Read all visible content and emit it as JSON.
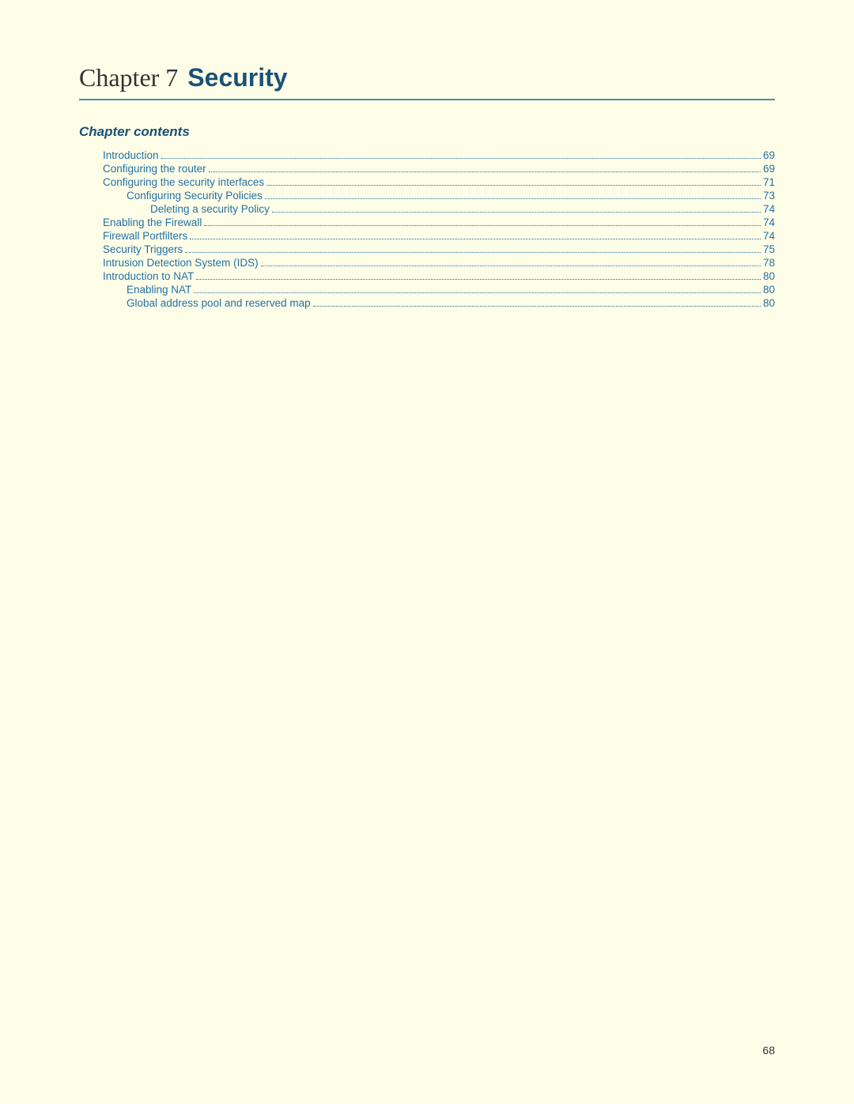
{
  "chapter": {
    "label": "Chapter 7",
    "title": "Security"
  },
  "section_heading": "Chapter contents",
  "toc": [
    {
      "indent": 1,
      "label": "Introduction",
      "page": "69"
    },
    {
      "indent": 1,
      "label": "Configuring the router",
      "page": "69"
    },
    {
      "indent": 1,
      "label": "Configuring the security interfaces",
      "page": "71"
    },
    {
      "indent": 2,
      "label": "Configuring Security Policies",
      "page": "73"
    },
    {
      "indent": 3,
      "label": "Deleting a security Policy",
      "page": "74"
    },
    {
      "indent": 1,
      "label": "Enabling the Firewall",
      "page": "74"
    },
    {
      "indent": 1,
      "label": "Firewall Portfilters",
      "page": "74"
    },
    {
      "indent": 1,
      "label": "Security Triggers",
      "page": "75"
    },
    {
      "indent": 1,
      "label": "Intrusion Detection System (IDS)",
      "page": "78"
    },
    {
      "indent": 1,
      "label": "Introduction to NAT",
      "page": "80"
    },
    {
      "indent": 2,
      "label": "Enabling NAT",
      "page": "80"
    },
    {
      "indent": 2,
      "label": "Global address pool and reserved map",
      "page": "80"
    }
  ],
  "page_number": "68"
}
